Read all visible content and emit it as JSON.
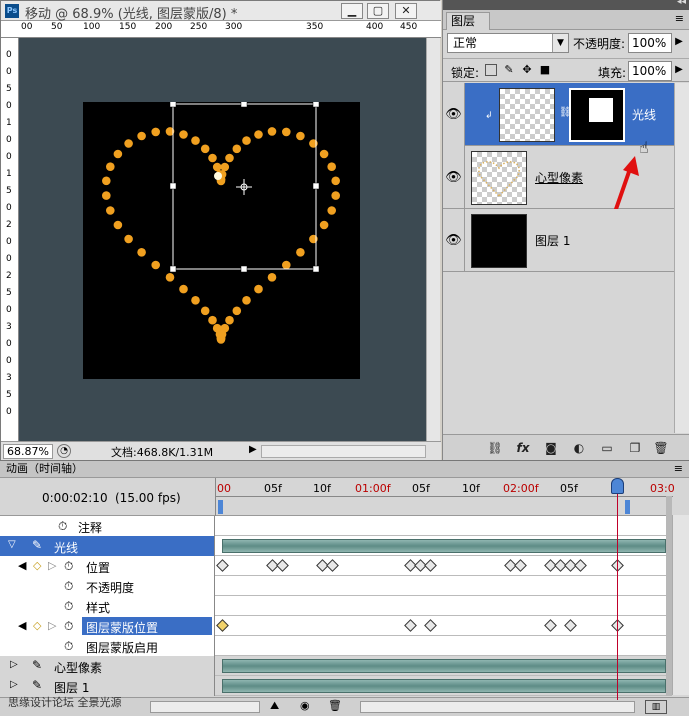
{
  "document": {
    "title": "移动 @ 68.9% (光线, 图层蒙版/8) *",
    "ruler_top": [
      "00",
      "50",
      "100",
      "150",
      "200",
      "250",
      "300",
      "350",
      "400",
      "450"
    ],
    "ruler_left": [
      "0",
      "0",
      "5",
      "0",
      "1",
      "0",
      "0",
      "1",
      "5",
      "0",
      "2",
      "0",
      "0",
      "2",
      "5",
      "0",
      "3",
      "0",
      "0",
      "3",
      "5",
      "0"
    ],
    "zoom": "68.87%",
    "info": "文档:468.8K/1.31M"
  },
  "layers_panel": {
    "tab": "图层",
    "blend_mode": "正常",
    "opacity_label": "不透明度:",
    "opacity": "100%",
    "lock_label": "锁定:",
    "fill_label": "填充:",
    "fill": "100%",
    "layers": [
      {
        "name": "光线",
        "selected": true
      },
      {
        "name": "心型像素",
        "selected": false
      },
      {
        "name": "图层 1",
        "selected": false
      }
    ]
  },
  "animation": {
    "tab": "动画（时间轴）",
    "timecode": "0:00:02:10",
    "fps": "(15.00 fps)",
    "ruler": [
      {
        "label": "00",
        "red": true
      },
      {
        "label": "05f",
        "red": false
      },
      {
        "label": "10f",
        "red": false
      },
      {
        "label": "01:00f",
        "red": true
      },
      {
        "label": "05f",
        "red": false
      },
      {
        "label": "10f",
        "red": false
      },
      {
        "label": "02:00f",
        "red": true
      },
      {
        "label": "05f",
        "red": false
      },
      {
        "label": "10f",
        "red": false
      },
      {
        "label": "03:0",
        "red": true
      }
    ],
    "rows": {
      "comment": "注释",
      "layer_light": "光线",
      "position": "位置",
      "opacity": "不透明度",
      "style": "样式",
      "mask_position": "图层蒙版位置",
      "mask_enable": "图层蒙版启用",
      "layer_heart": "心型像素",
      "layer_1": "图层 1"
    },
    "footer_text": "思缘设计论坛    全景光源"
  },
  "colors": {
    "selection": "#3a6ec5",
    "heart_dots": "#f0a020",
    "playhead": "#c0002a"
  }
}
